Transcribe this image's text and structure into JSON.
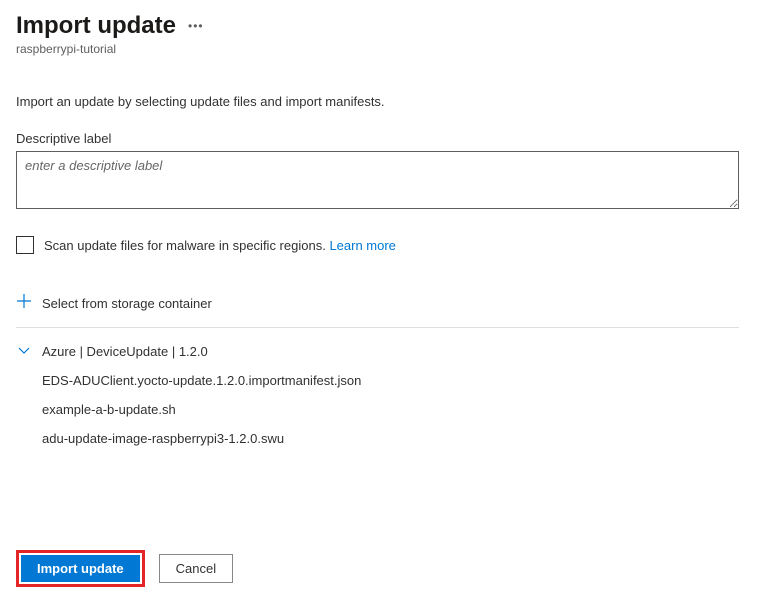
{
  "header": {
    "title": "Import update",
    "subtitle": "raspberrypi-tutorial"
  },
  "instructions": "Import an update by selecting update files and import manifests.",
  "descriptiveLabel": {
    "label": "Descriptive label",
    "placeholder": "enter a descriptive label",
    "value": ""
  },
  "scanCheckbox": {
    "label": "Scan update files for malware in specific regions.",
    "link": "Learn more",
    "checked": false
  },
  "storageAction": {
    "label": "Select from storage container"
  },
  "updateGroup": {
    "title": "Azure | DeviceUpdate | 1.2.0",
    "files": [
      "EDS-ADUClient.yocto-update.1.2.0.importmanifest.json",
      "example-a-b-update.sh",
      "adu-update-image-raspberrypi3-1.2.0.swu"
    ]
  },
  "footer": {
    "primary": "Import update",
    "secondary": "Cancel"
  }
}
